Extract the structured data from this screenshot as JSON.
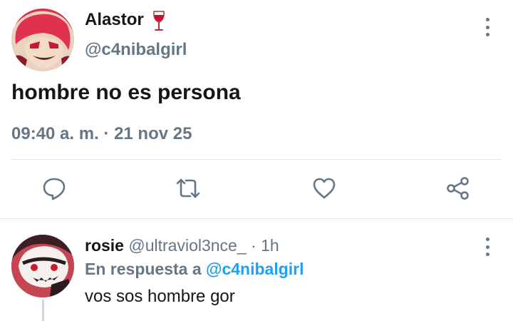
{
  "tweet": {
    "author_name": "Alastor",
    "author_emoji": "wine-glass-icon",
    "author_handle": "@c4nibalgirl",
    "text": "hombre no es persona",
    "timestamp": "09:40 a. m. · 21 nov 25",
    "actions": [
      "reply-icon",
      "retweet-icon",
      "like-icon",
      "share-icon"
    ]
  },
  "reply": {
    "author_name": "rosie",
    "author_handle": "@ultraviol3nce_",
    "separator": "·",
    "time": "1h",
    "in_reply_to_prefix": "En respuesta a",
    "in_reply_to_handle": "@c4nibalgirl",
    "text": "vos sos hombre gor"
  },
  "colors": {
    "text": "#14171a",
    "secondary": "#657786",
    "accent": "#1da1f2",
    "divider": "#e1e8ed"
  }
}
